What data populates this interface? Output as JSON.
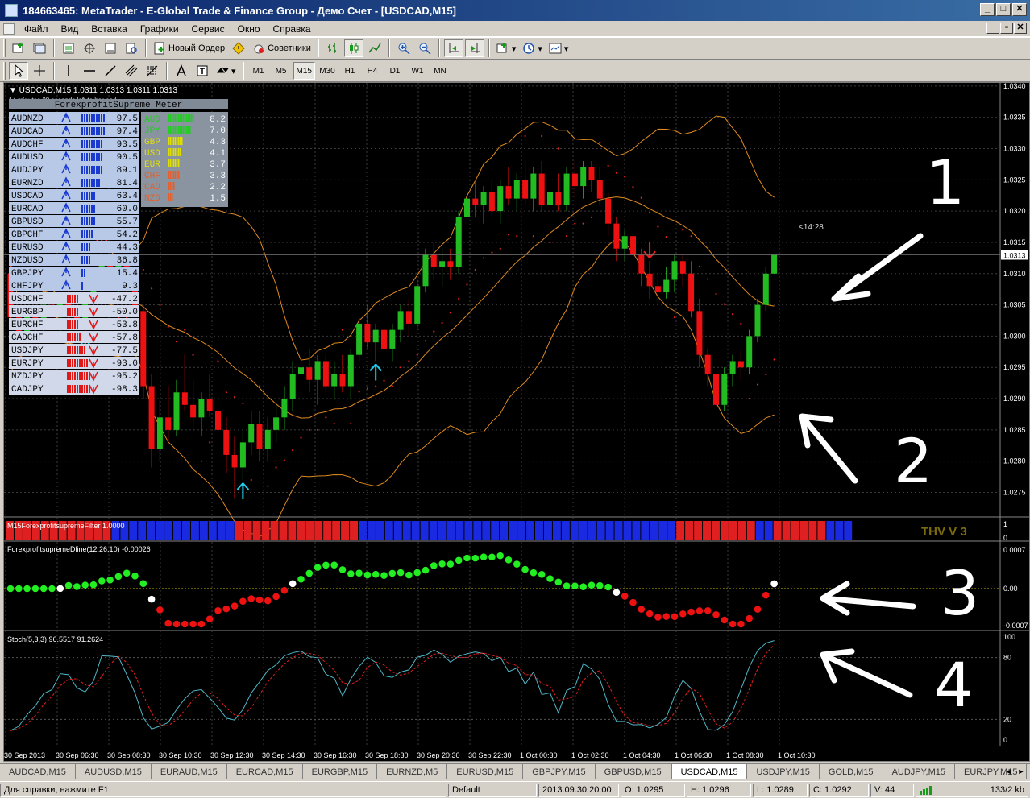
{
  "window": {
    "title": "184663465: MetaTrader - E-Global Trade & Finance Group - Демо Счет - [USDCAD,M15]",
    "min_label": "_",
    "max_label": "□",
    "close_label": "✕"
  },
  "menu": {
    "items": [
      "Файл",
      "Вид",
      "Вставка",
      "Графики",
      "Сервис",
      "Окно",
      "Справка"
    ],
    "mdi_min": "_",
    "mdi_restore": "▫",
    "mdi_close": "✕"
  },
  "toolbar": {
    "new_order_label": "Новый Ордер",
    "experts_label": "Советники",
    "timeframes": [
      "M1",
      "M5",
      "M15",
      "M30",
      "H1",
      "H4",
      "D1",
      "W1",
      "MN"
    ],
    "active_timeframe": "M15"
  },
  "chart": {
    "header": "USDCAD,M15  1.0311 1.0313 1.0311 1.0313",
    "countdown_text": "14 minutes 28 seconds left to bar end",
    "countdown_label": "<14:28",
    "current_price_tag": "1.0313",
    "price_ticks": [
      "1.0340",
      "1.0335",
      "1.0330",
      "1.0325",
      "1.0320",
      "1.0315",
      "1.0310",
      "1.0305",
      "1.0300",
      "1.0295",
      "1.0290",
      "1.0285",
      "1.0280",
      "1.0275"
    ],
    "time_ticks": [
      "30 Sep 2013",
      "30 Sep 06:30",
      "30 Sep 08:30",
      "30 Sep 10:30",
      "30 Sep 12:30",
      "30 Sep 14:30",
      "30 Sep 16:30",
      "30 Sep 18:30",
      "30 Sep 20:30",
      "30 Sep 22:30",
      "1 Oct 00:30",
      "1 Oct 02:30",
      "1 Oct 04:30",
      "1 Oct 06:30",
      "1 Oct 08:30",
      "1 Oct 10:30"
    ],
    "candles": [
      {
        "o": 1.031,
        "h": 1.0313,
        "l": 1.0302,
        "c": 1.0303
      },
      {
        "o": 1.0303,
        "h": 1.0306,
        "l": 1.0296,
        "c": 1.0299
      },
      {
        "o": 1.0299,
        "h": 1.0305,
        "l": 1.0297,
        "c": 1.0304
      },
      {
        "o": 1.0304,
        "h": 1.0308,
        "l": 1.03,
        "c": 1.0302
      },
      {
        "o": 1.0302,
        "h": 1.0306,
        "l": 1.0299,
        "c": 1.0305
      },
      {
        "o": 1.0305,
        "h": 1.0308,
        "l": 1.0301,
        "c": 1.0303
      },
      {
        "o": 1.0303,
        "h": 1.0307,
        "l": 1.03,
        "c": 1.0306
      },
      {
        "o": 1.0306,
        "h": 1.0309,
        "l": 1.0302,
        "c": 1.0304
      },
      {
        "o": 1.0304,
        "h": 1.0306,
        "l": 1.0299,
        "c": 1.0301
      },
      {
        "o": 1.0301,
        "h": 1.0307,
        "l": 1.03,
        "c": 1.0306
      },
      {
        "o": 1.0306,
        "h": 1.031,
        "l": 1.0303,
        "c": 1.0308
      },
      {
        "o": 1.0308,
        "h": 1.0314,
        "l": 1.0306,
        "c": 1.0313
      },
      {
        "o": 1.0313,
        "h": 1.0315,
        "l": 1.0308,
        "c": 1.031
      },
      {
        "o": 1.031,
        "h": 1.0313,
        "l": 1.0307,
        "c": 1.0312
      },
      {
        "o": 1.0312,
        "h": 1.0313,
        "l": 1.0307,
        "c": 1.0308
      },
      {
        "o": 1.0308,
        "h": 1.0311,
        "l": 1.0302,
        "c": 1.0304
      },
      {
        "o": 1.0304,
        "h": 1.0305,
        "l": 1.029,
        "c": 1.0292
      },
      {
        "o": 1.0292,
        "h": 1.0294,
        "l": 1.0279,
        "c": 1.0282
      },
      {
        "o": 1.0282,
        "h": 1.029,
        "l": 1.028,
        "c": 1.0287
      },
      {
        "o": 1.0287,
        "h": 1.0292,
        "l": 1.0283,
        "c": 1.0285
      },
      {
        "o": 1.0285,
        "h": 1.0293,
        "l": 1.0284,
        "c": 1.0291
      },
      {
        "o": 1.0291,
        "h": 1.0297,
        "l": 1.0288,
        "c": 1.0289
      },
      {
        "o": 1.0289,
        "h": 1.0293,
        "l": 1.0285,
        "c": 1.0287
      },
      {
        "o": 1.0287,
        "h": 1.0291,
        "l": 1.0284,
        "c": 1.029
      },
      {
        "o": 1.029,
        "h": 1.0294,
        "l": 1.0287,
        "c": 1.0288
      },
      {
        "o": 1.0288,
        "h": 1.0292,
        "l": 1.0283,
        "c": 1.0285
      },
      {
        "o": 1.0285,
        "h": 1.0287,
        "l": 1.0278,
        "c": 1.0281
      },
      {
        "o": 1.0281,
        "h": 1.0284,
        "l": 1.0274,
        "c": 1.0279
      },
      {
        "o": 1.0279,
        "h": 1.0285,
        "l": 1.0277,
        "c": 1.0283
      },
      {
        "o": 1.0283,
        "h": 1.0288,
        "l": 1.0281,
        "c": 1.0286
      },
      {
        "o": 1.0286,
        "h": 1.0288,
        "l": 1.028,
        "c": 1.0282
      },
      {
        "o": 1.0282,
        "h": 1.0287,
        "l": 1.028,
        "c": 1.0285
      },
      {
        "o": 1.0285,
        "h": 1.0289,
        "l": 1.0283,
        "c": 1.0287
      },
      {
        "o": 1.0287,
        "h": 1.0292,
        "l": 1.0285,
        "c": 1.029
      },
      {
        "o": 1.029,
        "h": 1.0296,
        "l": 1.0288,
        "c": 1.0294
      },
      {
        "o": 1.0294,
        "h": 1.0297,
        "l": 1.029,
        "c": 1.0295
      },
      {
        "o": 1.0295,
        "h": 1.0298,
        "l": 1.0291,
        "c": 1.0293
      },
      {
        "o": 1.0293,
        "h": 1.0297,
        "l": 1.0289,
        "c": 1.0296
      },
      {
        "o": 1.0296,
        "h": 1.0297,
        "l": 1.0291,
        "c": 1.0292
      },
      {
        "o": 1.0292,
        "h": 1.0296,
        "l": 1.029,
        "c": 1.0294
      },
      {
        "o": 1.0294,
        "h": 1.0297,
        "l": 1.0291,
        "c": 1.0292
      },
      {
        "o": 1.0292,
        "h": 1.0298,
        "l": 1.029,
        "c": 1.0297
      },
      {
        "o": 1.0297,
        "h": 1.0303,
        "l": 1.0296,
        "c": 1.0302
      },
      {
        "o": 1.0302,
        "h": 1.0305,
        "l": 1.0298,
        "c": 1.0299
      },
      {
        "o": 1.0299,
        "h": 1.0302,
        "l": 1.0296,
        "c": 1.0301
      },
      {
        "o": 1.0301,
        "h": 1.0303,
        "l": 1.0297,
        "c": 1.0298
      },
      {
        "o": 1.0298,
        "h": 1.0302,
        "l": 1.0296,
        "c": 1.0301
      },
      {
        "o": 1.0301,
        "h": 1.0305,
        "l": 1.0299,
        "c": 1.0304
      },
      {
        "o": 1.0304,
        "h": 1.0306,
        "l": 1.03,
        "c": 1.0302
      },
      {
        "o": 1.0302,
        "h": 1.0309,
        "l": 1.0301,
        "c": 1.0308
      },
      {
        "o": 1.0308,
        "h": 1.0314,
        "l": 1.0307,
        "c": 1.0313
      },
      {
        "o": 1.0313,
        "h": 1.0315,
        "l": 1.0309,
        "c": 1.0311
      },
      {
        "o": 1.0311,
        "h": 1.0314,
        "l": 1.0308,
        "c": 1.0312
      },
      {
        "o": 1.0312,
        "h": 1.0314,
        "l": 1.0309,
        "c": 1.0311
      },
      {
        "o": 1.0311,
        "h": 1.032,
        "l": 1.031,
        "c": 1.0319
      },
      {
        "o": 1.0319,
        "h": 1.0324,
        "l": 1.0317,
        "c": 1.0322
      },
      {
        "o": 1.0322,
        "h": 1.0325,
        "l": 1.0319,
        "c": 1.0321
      },
      {
        "o": 1.0321,
        "h": 1.0324,
        "l": 1.0318,
        "c": 1.0323
      },
      {
        "o": 1.0323,
        "h": 1.0325,
        "l": 1.0319,
        "c": 1.032
      },
      {
        "o": 1.032,
        "h": 1.0325,
        "l": 1.0318,
        "c": 1.0324
      },
      {
        "o": 1.0324,
        "h": 1.0327,
        "l": 1.0321,
        "c": 1.0322
      },
      {
        "o": 1.0322,
        "h": 1.0326,
        "l": 1.032,
        "c": 1.0325
      },
      {
        "o": 1.0325,
        "h": 1.0328,
        "l": 1.0321,
        "c": 1.0322
      },
      {
        "o": 1.0322,
        "h": 1.0327,
        "l": 1.032,
        "c": 1.0326
      },
      {
        "o": 1.0326,
        "h": 1.0328,
        "l": 1.032,
        "c": 1.0321
      },
      {
        "o": 1.0321,
        "h": 1.0325,
        "l": 1.0319,
        "c": 1.0323
      },
      {
        "o": 1.0323,
        "h": 1.0326,
        "l": 1.032,
        "c": 1.0321
      },
      {
        "o": 1.0321,
        "h": 1.0327,
        "l": 1.032,
        "c": 1.0326
      },
      {
        "o": 1.0326,
        "h": 1.0328,
        "l": 1.0322,
        "c": 1.0324
      },
      {
        "o": 1.0324,
        "h": 1.0328,
        "l": 1.0322,
        "c": 1.0327
      },
      {
        "o": 1.0327,
        "h": 1.0328,
        "l": 1.0323,
        "c": 1.0325
      },
      {
        "o": 1.0325,
        "h": 1.0327,
        "l": 1.0321,
        "c": 1.0322
      },
      {
        "o": 1.0322,
        "h": 1.0323,
        "l": 1.0316,
        "c": 1.0318
      },
      {
        "o": 1.0318,
        "h": 1.0319,
        "l": 1.0312,
        "c": 1.0314
      },
      {
        "o": 1.0314,
        "h": 1.0317,
        "l": 1.0312,
        "c": 1.0316
      },
      {
        "o": 1.0316,
        "h": 1.0317,
        "l": 1.0312,
        "c": 1.0313
      },
      {
        "o": 1.0313,
        "h": 1.0314,
        "l": 1.0308,
        "c": 1.031
      },
      {
        "o": 1.031,
        "h": 1.0312,
        "l": 1.0306,
        "c": 1.0308
      },
      {
        "o": 1.0308,
        "h": 1.031,
        "l": 1.0305,
        "c": 1.0307
      },
      {
        "o": 1.0307,
        "h": 1.0311,
        "l": 1.0306,
        "c": 1.0309
      },
      {
        "o": 1.0309,
        "h": 1.0313,
        "l": 1.0307,
        "c": 1.0312
      },
      {
        "o": 1.0312,
        "h": 1.0313,
        "l": 1.0308,
        "c": 1.031
      },
      {
        "o": 1.031,
        "h": 1.0312,
        "l": 1.0303,
        "c": 1.0304
      },
      {
        "o": 1.0304,
        "h": 1.0306,
        "l": 1.0295,
        "c": 1.0297
      },
      {
        "o": 1.0297,
        "h": 1.0298,
        "l": 1.0292,
        "c": 1.0294
      },
      {
        "o": 1.0294,
        "h": 1.0296,
        "l": 1.0287,
        "c": 1.0289
      },
      {
        "o": 1.0289,
        "h": 1.0295,
        "l": 1.0288,
        "c": 1.0294
      },
      {
        "o": 1.0294,
        "h": 1.0297,
        "l": 1.0292,
        "c": 1.0296
      },
      {
        "o": 1.0296,
        "h": 1.0298,
        "l": 1.0293,
        "c": 1.0295
      },
      {
        "o": 1.0295,
        "h": 1.0301,
        "l": 1.0294,
        "c": 1.03
      },
      {
        "o": 1.03,
        "h": 1.0306,
        "l": 1.0299,
        "c": 1.0305
      },
      {
        "o": 1.0305,
        "h": 1.0311,
        "l": 1.0304,
        "c": 1.031
      },
      {
        "o": 1.031,
        "h": 1.0313,
        "l": 1.031,
        "c": 1.0313
      }
    ],
    "meter": {
      "title": "ForexprofitSupreme Meter",
      "pairs": [
        {
          "name": "AUDNZD",
          "value": "97.5",
          "dir": "up"
        },
        {
          "name": "AUDCAD",
          "value": "97.4",
          "dir": "up"
        },
        {
          "name": "AUDCHF",
          "value": "93.5",
          "dir": "up"
        },
        {
          "name": "AUDUSD",
          "value": "90.5",
          "dir": "up"
        },
        {
          "name": "AUDJPY",
          "value": "89.1",
          "dir": "up"
        },
        {
          "name": "EURNZD",
          "value": "81.4",
          "dir": "up"
        },
        {
          "name": "USDCAD",
          "value": "63.4",
          "dir": "up"
        },
        {
          "name": "EURCAD",
          "value": "60.0",
          "dir": "up"
        },
        {
          "name": "GBPUSD",
          "value": "55.7",
          "dir": "up"
        },
        {
          "name": "GBPCHF",
          "value": "54.2",
          "dir": "up"
        },
        {
          "name": "EURUSD",
          "value": "44.3",
          "dir": "up"
        },
        {
          "name": "NZDUSD",
          "value": "36.8",
          "dir": "up"
        },
        {
          "name": "GBPJPY",
          "value": "15.4",
          "dir": "up"
        },
        {
          "name": "CHFJPY",
          "value": "9.3",
          "dir": "up"
        },
        {
          "name": "USDCHF",
          "value": "-47.2",
          "dir": "down"
        },
        {
          "name": "EURGBP",
          "value": "-50.0",
          "dir": "down"
        },
        {
          "name": "EURCHF",
          "value": "-53.8",
          "dir": "down"
        },
        {
          "name": "CADCHF",
          "value": "-57.8",
          "dir": "down"
        },
        {
          "name": "USDJPY",
          "value": "-77.5",
          "dir": "down"
        },
        {
          "name": "EURJPY",
          "value": "-93.0",
          "dir": "down"
        },
        {
          "name": "NZDJPY",
          "value": "-95.2",
          "dir": "down"
        },
        {
          "name": "CADJPY",
          "value": "-98.3",
          "dir": "down"
        }
      ],
      "currencies": [
        {
          "name": "AUD",
          "value": "8.2",
          "color": "#22cc22"
        },
        {
          "name": "JPY",
          "value": "7.0",
          "color": "#22cc22"
        },
        {
          "name": "GBP",
          "value": "4.3",
          "color": "#e0e000"
        },
        {
          "name": "USD",
          "value": "4.1",
          "color": "#e0e000"
        },
        {
          "name": "EUR",
          "value": "3.7",
          "color": "#e0e000"
        },
        {
          "name": "CHF",
          "value": "3.3",
          "color": "#e06030"
        },
        {
          "name": "CAD",
          "value": "2.2",
          "color": "#e06030"
        },
        {
          "name": "NZD",
          "value": "1.5",
          "color": "#e06030"
        }
      ]
    },
    "filter": {
      "label": "M15ForexprofitsupremeFilter 1.0000",
      "watermark": "THV V 3",
      "axis_top": "1",
      "axis_bottom": "0",
      "segments": [
        {
          "color": "red",
          "bars": 12
        },
        {
          "color": "blue",
          "bars": 14
        },
        {
          "color": "red",
          "bars": 14
        },
        {
          "color": "blue",
          "bars": 36
        },
        {
          "color": "red",
          "bars": 9
        },
        {
          "color": "blue",
          "bars": 2
        },
        {
          "color": "red",
          "bars": 6
        },
        {
          "color": "blue",
          "bars": 3
        }
      ]
    },
    "dline": {
      "label": "ForexprofitsupremeDline(12,26,10) -0.00026",
      "axis_labels": [
        "0.0007",
        "0.00",
        "-0.0007"
      ]
    },
    "stoch": {
      "label": "Stoch(5,3,3) 96.5517 91.2624",
      "axis_labels": [
        "100",
        "80",
        "20",
        "0"
      ]
    },
    "annotations": [
      "1",
      "2",
      "3",
      "4"
    ],
    "colors": {
      "bull": "#22bb22",
      "bear": "#ee1111",
      "band": "#e08a20",
      "sar": "#ee2222",
      "signal_up": "#22ccee",
      "signal_down": "#ee2222"
    }
  },
  "tabs": {
    "items": [
      "AUDCAD,M15",
      "AUDUSD,M15",
      "EURAUD,M15",
      "EURCAD,M15",
      "EURGBP,M15",
      "EURNZD,M5",
      "EURUSD,M15",
      "GBPJPY,M15",
      "GBPUSD,M15",
      "USDCAD,M15",
      "USDJPY,M15",
      "GOLD,M15",
      "AUDJPY,M15",
      "EURJPY,M15"
    ],
    "active": "USDCAD,M15",
    "nav_left": "◄",
    "nav_right": "►"
  },
  "status": {
    "help": "Для справки, нажмите F1",
    "profile": "Default",
    "datetime": "2013.09.30 20:00",
    "open": "O: 1.0295",
    "high": "H: 1.0296",
    "low": "L: 1.0289",
    "close": "C: 1.0292",
    "volume": "V: 44",
    "traffic": "133/2 kb"
  }
}
